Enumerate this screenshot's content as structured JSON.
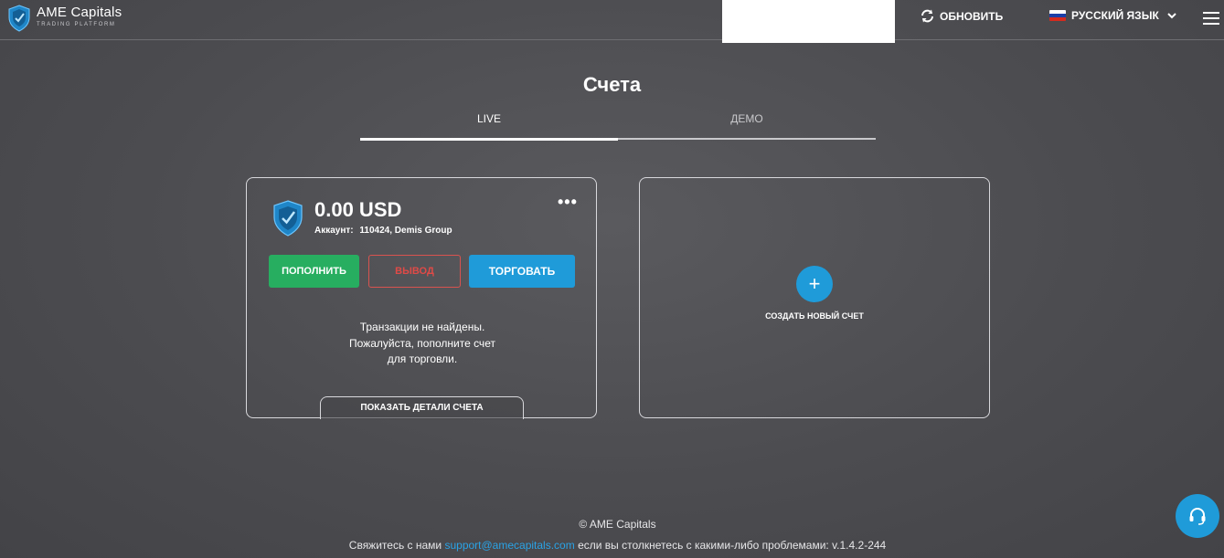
{
  "brand": {
    "name": "AME Capitals",
    "tagline": "TRADING PLATFORM"
  },
  "header": {
    "refresh_label": "ОБНОВИТЬ",
    "language_label": "РУССКИЙ ЯЗЫК"
  },
  "page": {
    "title": "Счета",
    "tabs": [
      {
        "label": "LIVE",
        "active": true
      },
      {
        "label": "ДЕМО",
        "active": false
      }
    ]
  },
  "account": {
    "balance": "0.00 USD",
    "account_label": "Аккаунт:",
    "account_value": "110424, Demis Group",
    "more_label": "•••",
    "deposit_label": "ПОПОЛНИТЬ",
    "withdraw_label": "ВЫВОД",
    "trade_label": "ТОРГОВАТЬ",
    "empty_line1": "Транзакции не найдены.",
    "empty_line2": "Пожалуйста, пополните счет",
    "empty_line3": "для торговли.",
    "details_label": "ПОКАЗАТЬ ДЕТАЛИ СЧЕТА"
  },
  "create": {
    "plus": "+",
    "label": "СОЗДАТЬ НОВЫЙ СЧЕТ"
  },
  "footer": {
    "copyright": "© AME Capitals",
    "contact_prefix": "Свяжитесь с нами",
    "email": "support@amecapitals.com",
    "contact_suffix": "если вы столкнетесь с какими-либо проблемами: v.1.4.2-244"
  },
  "colors": {
    "accent": "#1f9bd9",
    "deposit": "#27ae60",
    "withdraw": "#e04a47"
  },
  "icons": {
    "logo": "shield-logo-icon",
    "refresh": "refresh-icon",
    "flag": "russia-flag-icon",
    "menu": "hamburger-icon",
    "support": "headset-icon"
  }
}
